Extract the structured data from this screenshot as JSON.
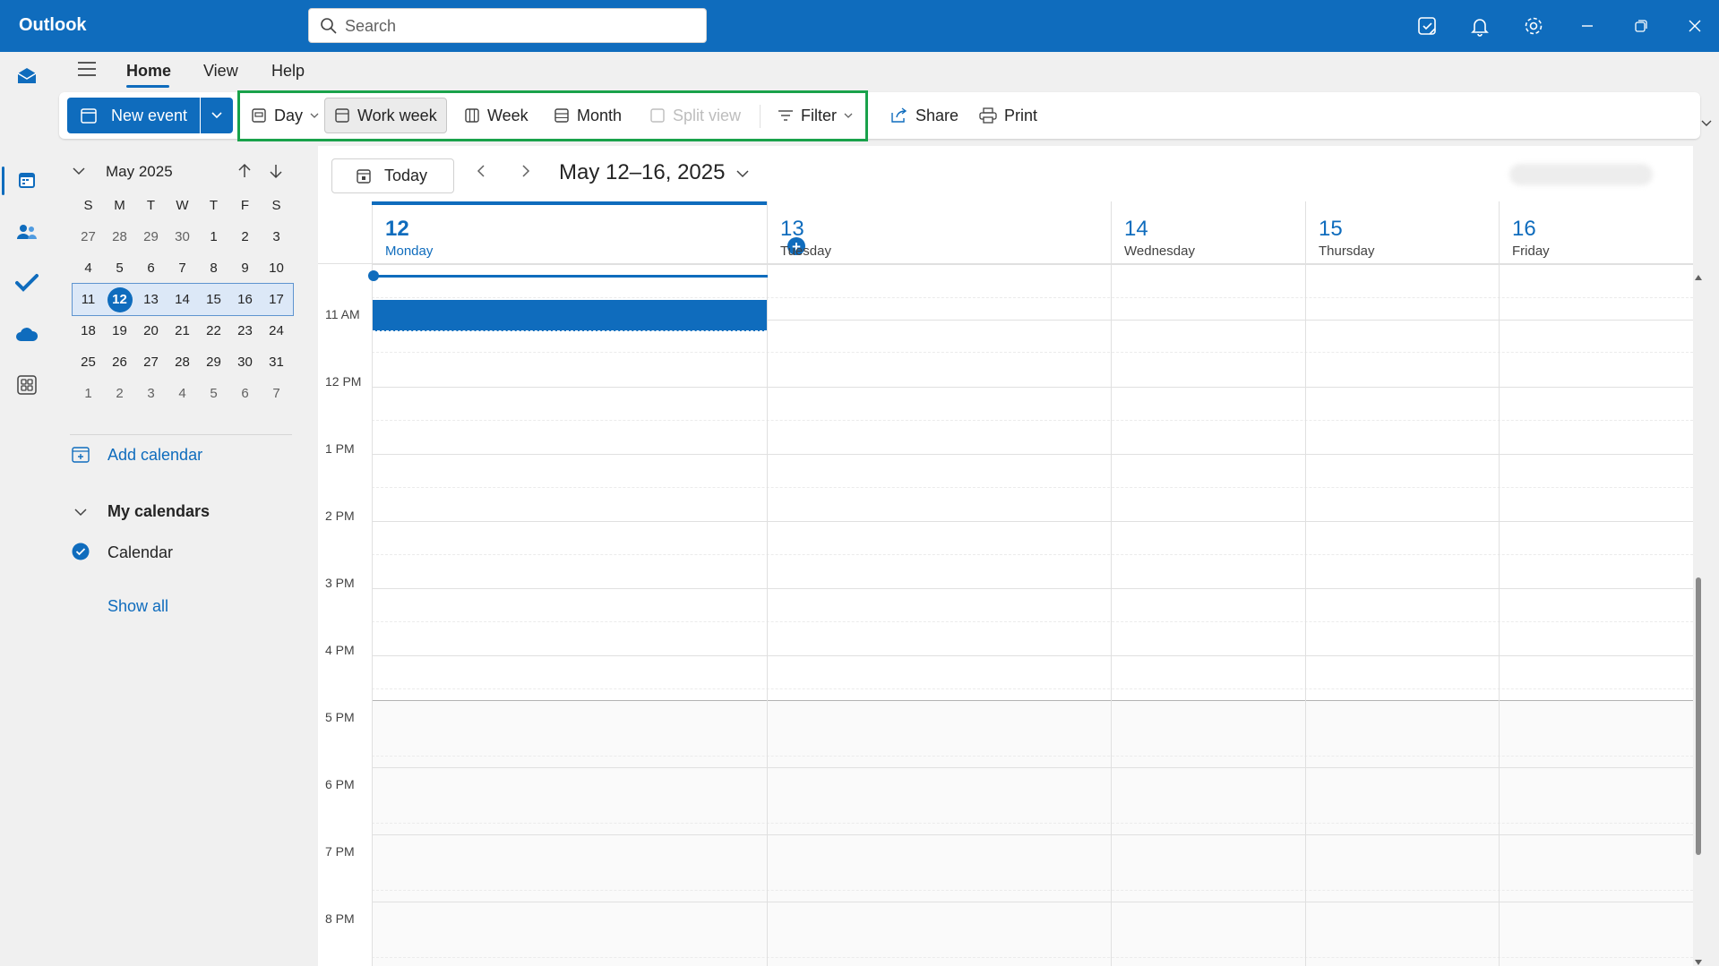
{
  "app": {
    "title": "Outlook"
  },
  "search": {
    "placeholder": "Search"
  },
  "ribbon": {
    "tabs": [
      {
        "label": "Home"
      },
      {
        "label": "View"
      },
      {
        "label": "Help"
      }
    ]
  },
  "toolbar": {
    "new_event": "New event",
    "day": "Day",
    "work_week": "Work week",
    "week": "Week",
    "month": "Month",
    "split_view": "Split view",
    "filter": "Filter",
    "share": "Share",
    "print": "Print"
  },
  "mini_calendar": {
    "month_label": "May 2025",
    "weekdays": [
      "S",
      "M",
      "T",
      "W",
      "T",
      "F",
      "S"
    ],
    "weeks": [
      [
        "27",
        "28",
        "29",
        "30",
        "1",
        "2",
        "3"
      ],
      [
        "4",
        "5",
        "6",
        "7",
        "8",
        "9",
        "10"
      ],
      [
        "11",
        "12",
        "13",
        "14",
        "15",
        "16",
        "17"
      ],
      [
        "18",
        "19",
        "20",
        "21",
        "22",
        "23",
        "24"
      ],
      [
        "25",
        "26",
        "27",
        "28",
        "29",
        "30",
        "31"
      ],
      [
        "1",
        "2",
        "3",
        "4",
        "5",
        "6",
        "7"
      ]
    ]
  },
  "sidebar": {
    "add_calendar": "Add calendar",
    "my_calendars": "My calendars",
    "calendar_item": "Calendar",
    "show_all": "Show all"
  },
  "calendar": {
    "today_button": "Today",
    "range": "May 12–16, 2025",
    "days": [
      {
        "num": "12",
        "name": "Monday"
      },
      {
        "num": "13",
        "name": "Tuesday"
      },
      {
        "num": "14",
        "name": "Wednesday"
      },
      {
        "num": "15",
        "name": "Thursday"
      },
      {
        "num": "16",
        "name": "Friday"
      }
    ],
    "times": [
      "11 AM",
      "12 PM",
      "1 PM",
      "2 PM",
      "3 PM",
      "4 PM",
      "5 PM",
      "6 PM",
      "7 PM",
      "8 PM"
    ]
  },
  "colors": {
    "brand": "#0f6cbd",
    "highlight": "#19a24b"
  }
}
